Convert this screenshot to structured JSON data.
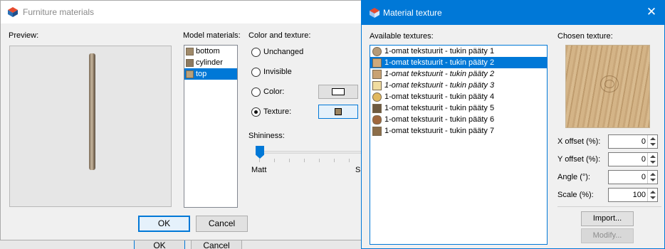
{
  "background": {
    "ok_label": "OK",
    "cancel_label": "Cancel"
  },
  "furniture_dialog": {
    "title": "Furniture materials",
    "preview_label": "Preview:",
    "model_materials_label": "Model materials:",
    "materials": [
      {
        "label": "bottom",
        "selected": false
      },
      {
        "label": "cylinder",
        "selected": false
      },
      {
        "label": "top",
        "selected": true
      }
    ],
    "color_texture_label": "Color and texture:",
    "options": {
      "unchanged": "Unchanged",
      "invisible": "Invisible",
      "color": "Color:",
      "texture": "Texture:",
      "selected": "texture"
    },
    "shininess_label": "Shininess:",
    "shininess_min_label": "Matt",
    "shininess_max_label_partial": "Sh",
    "shininess_value": 0,
    "ok_label": "OK",
    "cancel_label": "Cancel"
  },
  "texture_dialog": {
    "title": "Material texture",
    "available_label": "Available textures:",
    "textures": [
      {
        "label": "1-omat tekstuurit - tukin pääty 1",
        "italic": false,
        "selected": false
      },
      {
        "label": "1-omat tekstuurit - tukin pääty 2",
        "italic": false,
        "selected": true
      },
      {
        "label": "1-omat tekstuurit - tukin pääty 2",
        "italic": true,
        "selected": false
      },
      {
        "label": "1-omat tekstuurit - tukin pääty 3",
        "italic": true,
        "selected": false
      },
      {
        "label": "1-omat tekstuurit - tukin pääty 4",
        "italic": false,
        "selected": false
      },
      {
        "label": "1-omat tekstuurit - tukin pääty  5",
        "italic": false,
        "selected": false
      },
      {
        "label": "1-omat tekstuurit - tukin pääty 6",
        "italic": false,
        "selected": false
      },
      {
        "label": "1-omat tekstuurit - tukin pääty 7",
        "italic": false,
        "selected": false
      }
    ],
    "chosen_label": "Chosen texture:",
    "fields": {
      "x_offset_label": "X offset (%):",
      "x_offset": "0",
      "y_offset_label": "Y offset (%):",
      "y_offset": "0",
      "angle_label": "Angle (°):",
      "angle": "0",
      "scale_label": "Scale (%):",
      "scale": "100"
    },
    "import_label": "Import...",
    "modify_label": "Modify..."
  }
}
